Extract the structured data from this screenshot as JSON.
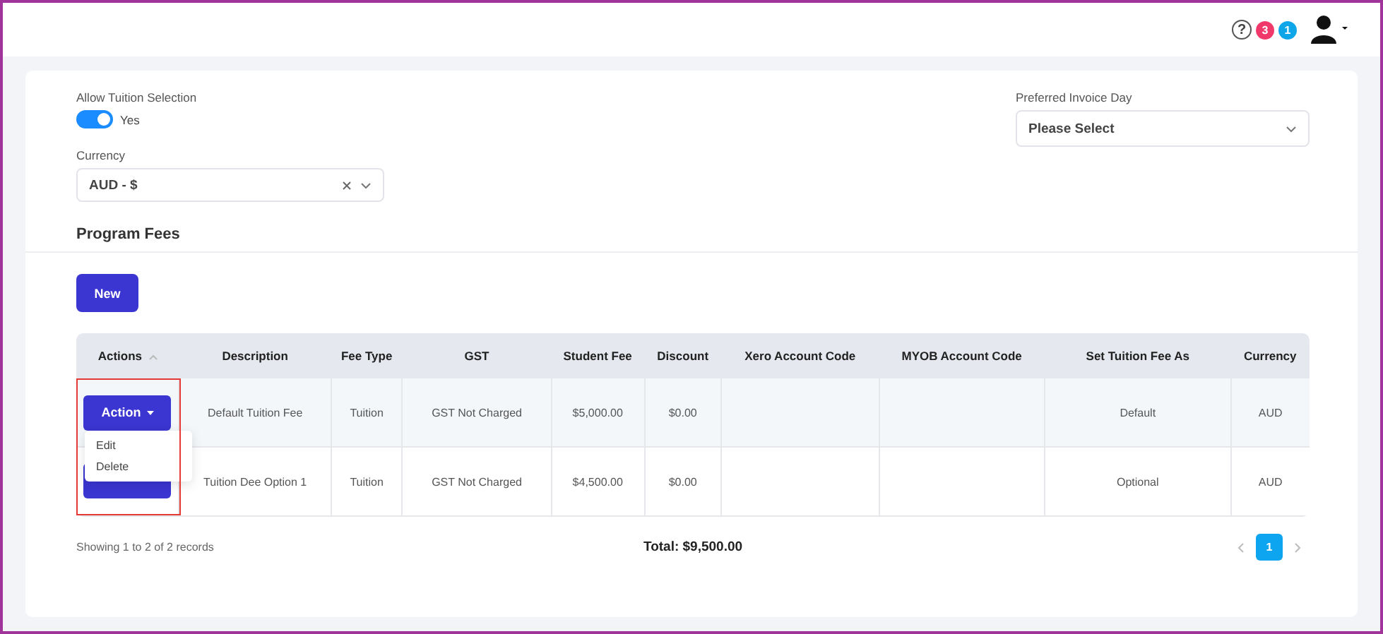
{
  "header": {
    "help": "?",
    "badges": [
      {
        "count": "3",
        "color": "#f0386b"
      },
      {
        "count": "1",
        "color": "#0ea5e9"
      }
    ]
  },
  "settings": {
    "allow_tuition": {
      "label": "Allow Tuition Selection",
      "on": true,
      "value_label": "Yes"
    },
    "currency": {
      "label": "Currency",
      "value": "AUD - $"
    },
    "invoice_day": {
      "label": "Preferred Invoice Day",
      "placeholder": "Please Select"
    }
  },
  "program_fees": {
    "title": "Program Fees",
    "new_button": "New",
    "table": {
      "highlight_actions": true,
      "columns": [
        {
          "label": "Actions",
          "sortable": true
        },
        {
          "label": "Description"
        },
        {
          "label": "Fee Type"
        },
        {
          "label": "GST"
        },
        {
          "label": "Student Fee"
        },
        {
          "label": "Discount"
        },
        {
          "label": "Xero Account Code"
        },
        {
          "label": "MYOB Account Code"
        },
        {
          "label": "Set Tuition Fee As"
        },
        {
          "label": "Currency"
        }
      ],
      "rows": [
        {
          "cells": [
            {
              "kind": "action",
              "label": "Action",
              "menu_open": true,
              "menu": [
                "Edit",
                "Delete"
              ]
            },
            "Default Tuition Fee",
            "Tuition",
            "GST Not Charged",
            "$5,000.00",
            "$0.00",
            "",
            "",
            "Default",
            "AUD"
          ]
        },
        {
          "cells": [
            {
              "kind": "action",
              "menu_open": false
            },
            "Tuition Dee Option 1",
            "Tuition",
            "GST Not Charged",
            "$4,500.00",
            "$0.00",
            "",
            "",
            "Optional",
            "AUD"
          ]
        }
      ]
    },
    "summary": "Showing 1 to 2 of 2 records",
    "total": "Total: $9,500.00",
    "pages": [
      {
        "label": "1",
        "selected": true
      }
    ]
  }
}
